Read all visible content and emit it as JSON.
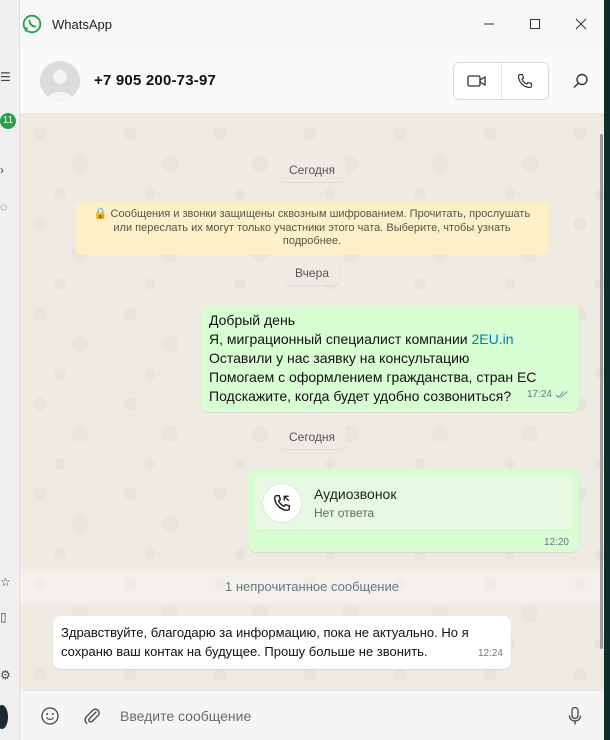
{
  "app": {
    "title": "WhatsApp"
  },
  "rail": {
    "badge": "11"
  },
  "window_controls": {
    "minimize": "—",
    "maximize": "☐",
    "close": "✕"
  },
  "header": {
    "contact": "+7 905 200-73-97"
  },
  "chat": {
    "date_today_1": "Сегодня",
    "encryption_notice": "🔒 Сообщения и звонки защищены сквозным шифрованием. Прочитать, прослушать или переслать их могут только участники этого чата. Выберите, чтобы узнать подробнее.",
    "date_yesterday": "Вчера",
    "outgoing_message": {
      "line1": "Добрый день",
      "line2_prefix": "Я, миграционный специалист компании ",
      "line2_link": "2EU.in",
      "line3": "Оставили у нас заявку на консультацию",
      "line4": "Помогаем с оформлением гражданства, стран ЕС",
      "line5": "Подскажите, когда будет удобно созвониться?",
      "time": "17:24"
    },
    "date_today_2": "Сегодня",
    "call_message": {
      "title": "Аудиозвонок",
      "status": "Нет ответа",
      "time": "12:20"
    },
    "unread_label": "1 непрочитанное сообщение",
    "incoming_message": {
      "text": "Здравствуйте, благодарю за информацию, пока не актуально. Но я сохраню ваш контак на будущее. Прошу больше не звонить.",
      "time": "12:24"
    }
  },
  "composer": {
    "placeholder": "Введите сообщение"
  },
  "colors": {
    "outgoing_bubble": "#d9fdd3",
    "incoming_bubble": "#ffffff",
    "notice": "#fbf0c8",
    "brand": "#25a244"
  }
}
